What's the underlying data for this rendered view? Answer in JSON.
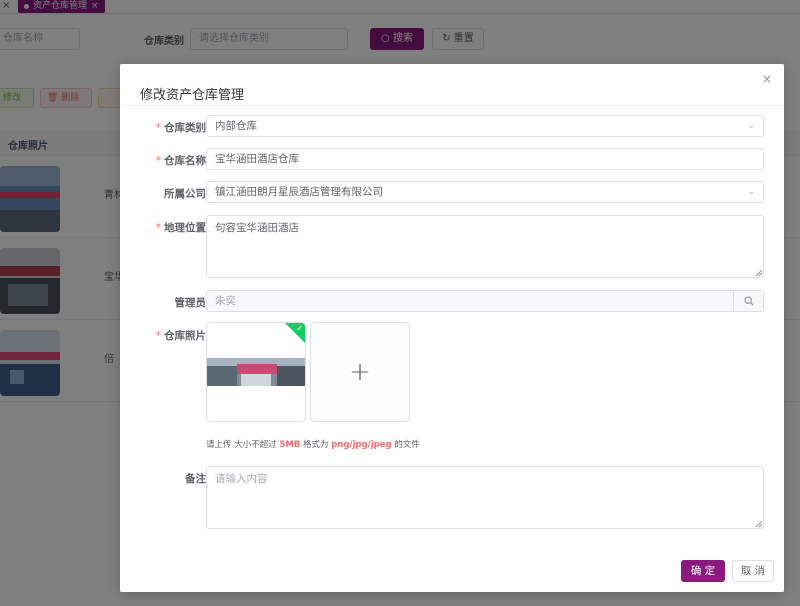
{
  "tabs": {
    "close_glyph": "×",
    "active_label": "资产仓库管理",
    "active_close": "×"
  },
  "search": {
    "name_placeholder": "仓库名称",
    "category_label": "仓库类别",
    "category_placeholder": "请选择仓库类别",
    "search_label": "搜索",
    "reset_label": "重置"
  },
  "toolbar": {
    "edit_label": "修改",
    "delete_label": "删除"
  },
  "table": {
    "col_photo": "仓库照片",
    "rows": [
      {
        "name": "青林"
      },
      {
        "name": "宝华"
      },
      {
        "name": "倍"
      }
    ]
  },
  "dialog": {
    "title": "修改资产仓库管理",
    "close_glyph": "×",
    "required_mark": "*",
    "fields": {
      "category": {
        "label": "仓库类别",
        "value": "内部仓库"
      },
      "name": {
        "label": "仓库名称",
        "value": "宝华涵田酒店仓库"
      },
      "company": {
        "label": "所属公司",
        "value": "镇江涵田朗月星辰酒店管理有限公司"
      },
      "location": {
        "label": "地理位置",
        "value": "句容宝华涵田酒店"
      },
      "manager": {
        "label": "管理员",
        "value": "朱奕"
      },
      "photo": {
        "label": "仓库照片"
      },
      "remark": {
        "label": "备注",
        "placeholder": "请输入内容"
      }
    },
    "upload_tip": {
      "prefix": "请上传 大小不超过",
      "size": "5MB",
      "middle": "格式为",
      "formats": "png/jpg/jpeg",
      "suffix": "的文件"
    },
    "ok_label": "确 定",
    "cancel_label": "取 消"
  },
  "colors": {
    "primary": "#8b1a7e",
    "success": "#13ce66",
    "danger": "#f56c6c"
  },
  "icons": {
    "close": "×",
    "chevron_down": "⌄",
    "check": "✓",
    "plus": "+"
  }
}
